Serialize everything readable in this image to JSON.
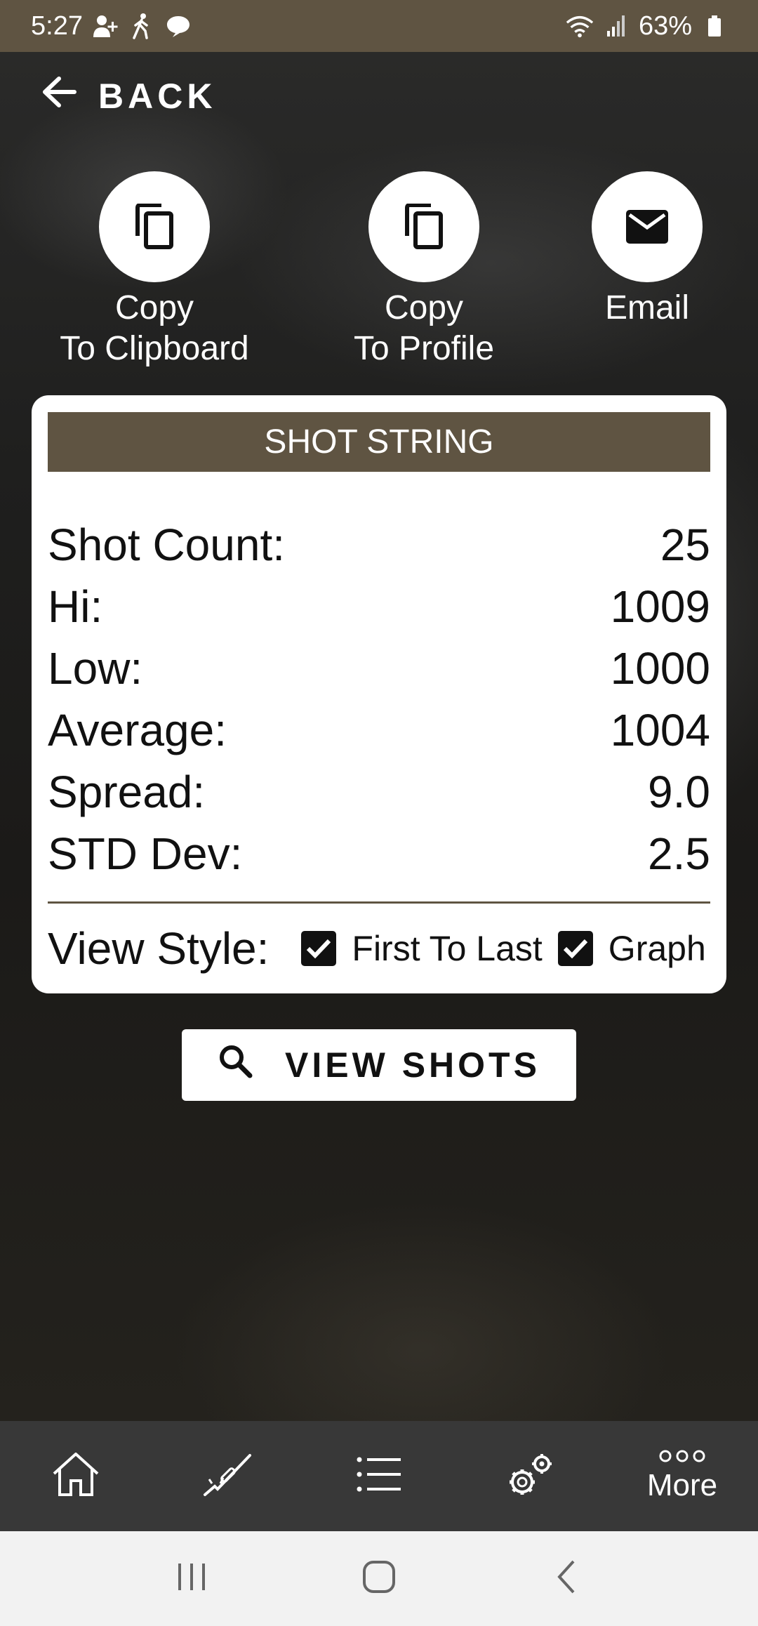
{
  "status_bar": {
    "time": "5:27",
    "battery": "63%",
    "left_icons": [
      "person-add-icon",
      "walking-icon",
      "chat-bubble-icon"
    ],
    "right_icons": [
      "wifi-icon",
      "signal-icon",
      "battery-icon"
    ]
  },
  "header": {
    "back_label": "BACK"
  },
  "actions": [
    {
      "line1": "Copy",
      "line2": "To Clipboard",
      "icon": "copy-icon"
    },
    {
      "line1": "Copy",
      "line2": "To Profile",
      "icon": "copy-icon"
    },
    {
      "line1": "Email",
      "line2": "",
      "icon": "email-icon"
    }
  ],
  "shot_string": {
    "title": "SHOT STRING",
    "stats": [
      {
        "label": "Shot Count:",
        "value": "25"
      },
      {
        "label": "Hi:",
        "value": "1009"
      },
      {
        "label": "Low:",
        "value": "1000"
      },
      {
        "label": "Average:",
        "value": "1004"
      },
      {
        "label": "Spread:",
        "value": "9.0"
      },
      {
        "label": "STD Dev:",
        "value": "2.5"
      }
    ],
    "view_style_label": "View Style:",
    "options": [
      {
        "label": "First To Last",
        "checked": true
      },
      {
        "label": "Graph",
        "checked": true
      }
    ]
  },
  "view_shots": {
    "label": "VIEW SHOTS",
    "icon": "search-icon"
  },
  "bottom_nav": {
    "items": [
      "home-icon",
      "rifle-icon",
      "list-icon",
      "settings-gears-icon",
      "more-icon"
    ],
    "more_label": "More"
  },
  "system_nav": [
    "recent-apps-icon",
    "home-button-icon",
    "back-arrow-icon"
  ],
  "colors": {
    "accent": "#5f5442",
    "nav_bg": "#383838"
  }
}
